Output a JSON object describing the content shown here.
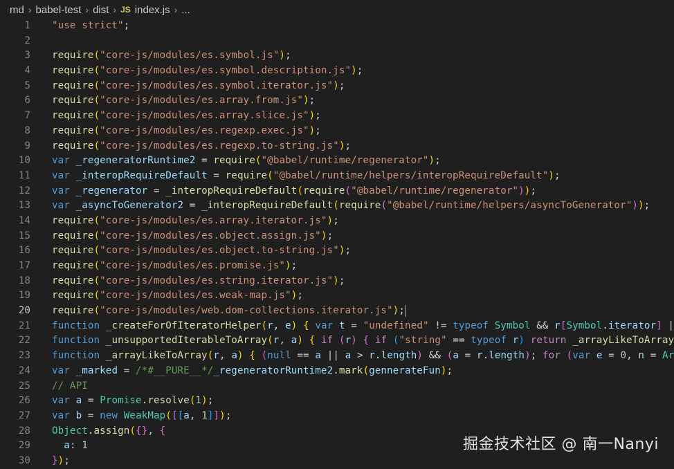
{
  "breadcrumb": {
    "items": [
      "md",
      "babel-test",
      "dist"
    ],
    "file_badge": "JS",
    "file_name": "index.js",
    "more": "..."
  },
  "editor": {
    "active_line": 20,
    "line_numbers": [
      "1",
      "2",
      "3",
      "4",
      "5",
      "6",
      "7",
      "8",
      "9",
      "10",
      "11",
      "12",
      "13",
      "14",
      "15",
      "16",
      "17",
      "18",
      "19",
      "20",
      "21",
      "22",
      "23",
      "24",
      "25",
      "26",
      "27",
      "28",
      "29",
      "30"
    ],
    "lines": [
      [
        [
          "str",
          "\"use strict\""
        ],
        [
          "op",
          ";"
        ]
      ],
      [],
      [
        [
          "fn",
          "require"
        ],
        [
          "pn",
          "("
        ],
        [
          "str",
          "\"core-js/modules/es.symbol.js\""
        ],
        [
          "pn",
          ")"
        ],
        [
          "op",
          ";"
        ]
      ],
      [
        [
          "fn",
          "require"
        ],
        [
          "pn",
          "("
        ],
        [
          "str",
          "\"core-js/modules/es.symbol.description.js\""
        ],
        [
          "pn",
          ")"
        ],
        [
          "op",
          ";"
        ]
      ],
      [
        [
          "fn",
          "require"
        ],
        [
          "pn",
          "("
        ],
        [
          "str",
          "\"core-js/modules/es.symbol.iterator.js\""
        ],
        [
          "pn",
          ")"
        ],
        [
          "op",
          ";"
        ]
      ],
      [
        [
          "fn",
          "require"
        ],
        [
          "pn",
          "("
        ],
        [
          "str",
          "\"core-js/modules/es.array.from.js\""
        ],
        [
          "pn",
          ")"
        ],
        [
          "op",
          ";"
        ]
      ],
      [
        [
          "fn",
          "require"
        ],
        [
          "pn",
          "("
        ],
        [
          "str",
          "\"core-js/modules/es.array.slice.js\""
        ],
        [
          "pn",
          ")"
        ],
        [
          "op",
          ";"
        ]
      ],
      [
        [
          "fn",
          "require"
        ],
        [
          "pn",
          "("
        ],
        [
          "str",
          "\"core-js/modules/es.regexp.exec.js\""
        ],
        [
          "pn",
          ")"
        ],
        [
          "op",
          ";"
        ]
      ],
      [
        [
          "fn",
          "require"
        ],
        [
          "pn",
          "("
        ],
        [
          "str",
          "\"core-js/modules/es.regexp.to-string.js\""
        ],
        [
          "pn",
          ")"
        ],
        [
          "op",
          ";"
        ]
      ],
      [
        [
          "kw",
          "var"
        ],
        [
          "op",
          " "
        ],
        [
          "var",
          "_regeneratorRuntime2"
        ],
        [
          "op",
          " = "
        ],
        [
          "fn",
          "require"
        ],
        [
          "pn",
          "("
        ],
        [
          "str",
          "\"@babel/runtime/regenerator\""
        ],
        [
          "pn",
          ")"
        ],
        [
          "op",
          ";"
        ]
      ],
      [
        [
          "kw",
          "var"
        ],
        [
          "op",
          " "
        ],
        [
          "var",
          "_interopRequireDefault"
        ],
        [
          "op",
          " = "
        ],
        [
          "fn",
          "require"
        ],
        [
          "pn",
          "("
        ],
        [
          "str",
          "\"@babel/runtime/helpers/interopRequireDefault\""
        ],
        [
          "pn",
          ")"
        ],
        [
          "op",
          ";"
        ]
      ],
      [
        [
          "kw",
          "var"
        ],
        [
          "op",
          " "
        ],
        [
          "var",
          "_regenerator"
        ],
        [
          "op",
          " = "
        ],
        [
          "fn",
          "_interopRequireDefault"
        ],
        [
          "pn",
          "("
        ],
        [
          "fn",
          "require"
        ],
        [
          "pn2",
          "("
        ],
        [
          "str",
          "\"@babel/runtime/regenerator\""
        ],
        [
          "pn2",
          ")"
        ],
        [
          "pn",
          ")"
        ],
        [
          "op",
          ";"
        ]
      ],
      [
        [
          "kw",
          "var"
        ],
        [
          "op",
          " "
        ],
        [
          "var",
          "_asyncToGenerator2"
        ],
        [
          "op",
          " = "
        ],
        [
          "fn",
          "_interopRequireDefault"
        ],
        [
          "pn",
          "("
        ],
        [
          "fn",
          "require"
        ],
        [
          "pn2",
          "("
        ],
        [
          "str",
          "\"@babel/runtime/helpers/asyncToGenerator\""
        ],
        [
          "pn2",
          ")"
        ],
        [
          "pn",
          ")"
        ],
        [
          "op",
          ";"
        ]
      ],
      [
        [
          "fn",
          "require"
        ],
        [
          "pn",
          "("
        ],
        [
          "str",
          "\"core-js/modules/es.array.iterator.js\""
        ],
        [
          "pn",
          ")"
        ],
        [
          "op",
          ";"
        ]
      ],
      [
        [
          "fn",
          "require"
        ],
        [
          "pn",
          "("
        ],
        [
          "str",
          "\"core-js/modules/es.object.assign.js\""
        ],
        [
          "pn",
          ")"
        ],
        [
          "op",
          ";"
        ]
      ],
      [
        [
          "fn",
          "require"
        ],
        [
          "pn",
          "("
        ],
        [
          "str",
          "\"core-js/modules/es.object.to-string.js\""
        ],
        [
          "pn",
          ")"
        ],
        [
          "op",
          ";"
        ]
      ],
      [
        [
          "fn",
          "require"
        ],
        [
          "pn",
          "("
        ],
        [
          "str",
          "\"core-js/modules/es.promise.js\""
        ],
        [
          "pn",
          ")"
        ],
        [
          "op",
          ";"
        ]
      ],
      [
        [
          "fn",
          "require"
        ],
        [
          "pn",
          "("
        ],
        [
          "str",
          "\"core-js/modules/es.string.iterator.js\""
        ],
        [
          "pn",
          ")"
        ],
        [
          "op",
          ";"
        ]
      ],
      [
        [
          "fn",
          "require"
        ],
        [
          "pn",
          "("
        ],
        [
          "str",
          "\"core-js/modules/es.weak-map.js\""
        ],
        [
          "pn",
          ")"
        ],
        [
          "op",
          ";"
        ]
      ],
      [
        [
          "fn",
          "require"
        ],
        [
          "pn",
          "("
        ],
        [
          "str",
          "\"core-js/modules/web.dom-collections.iterator.js\""
        ],
        [
          "pn",
          ")"
        ],
        [
          "op",
          ";"
        ],
        [
          "cursor",
          ""
        ]
      ],
      [
        [
          "kw",
          "function"
        ],
        [
          "op",
          " "
        ],
        [
          "fn",
          "_createForOfIteratorHelper"
        ],
        [
          "pn",
          "("
        ],
        [
          "var",
          "r"
        ],
        [
          "op",
          ", "
        ],
        [
          "var",
          "e"
        ],
        [
          "pn",
          ")"
        ],
        [
          "op",
          " "
        ],
        [
          "pn",
          "{"
        ],
        [
          "op",
          " "
        ],
        [
          "kw",
          "var"
        ],
        [
          "op",
          " "
        ],
        [
          "var",
          "t"
        ],
        [
          "op",
          " = "
        ],
        [
          "str",
          "\"undefined\""
        ],
        [
          "op",
          " != "
        ],
        [
          "kw",
          "typeof"
        ],
        [
          "op",
          " "
        ],
        [
          "cls",
          "Symbol"
        ],
        [
          "op",
          " && "
        ],
        [
          "var",
          "r"
        ],
        [
          "pn2",
          "["
        ],
        [
          "cls",
          "Symbol"
        ],
        [
          "op",
          "."
        ],
        [
          "var",
          "iterator"
        ],
        [
          "pn2",
          "]"
        ],
        [
          "op",
          " |"
        ]
      ],
      [
        [
          "kw",
          "function"
        ],
        [
          "op",
          " "
        ],
        [
          "fn",
          "_unsupportedIterableToArray"
        ],
        [
          "pn",
          "("
        ],
        [
          "var",
          "r"
        ],
        [
          "op",
          ", "
        ],
        [
          "var",
          "a"
        ],
        [
          "pn",
          ")"
        ],
        [
          "op",
          " "
        ],
        [
          "pn",
          "{"
        ],
        [
          "op",
          " "
        ],
        [
          "kw2",
          "if"
        ],
        [
          "op",
          " "
        ],
        [
          "pn2",
          "("
        ],
        [
          "var",
          "r"
        ],
        [
          "pn2",
          ")"
        ],
        [
          "op",
          " "
        ],
        [
          "pn2",
          "{"
        ],
        [
          "op",
          " "
        ],
        [
          "kw2",
          "if"
        ],
        [
          "op",
          " "
        ],
        [
          "pn3",
          "("
        ],
        [
          "str",
          "\"string\""
        ],
        [
          "op",
          " == "
        ],
        [
          "kw",
          "typeof"
        ],
        [
          "op",
          " "
        ],
        [
          "var",
          "r"
        ],
        [
          "pn3",
          ")"
        ],
        [
          "op",
          " "
        ],
        [
          "kw2",
          "return"
        ],
        [
          "op",
          " "
        ],
        [
          "fn",
          "_arrayLikeToArray"
        ]
      ],
      [
        [
          "kw",
          "function"
        ],
        [
          "op",
          " "
        ],
        [
          "fn",
          "_arrayLikeToArray"
        ],
        [
          "pn",
          "("
        ],
        [
          "var",
          "r"
        ],
        [
          "op",
          ", "
        ],
        [
          "var",
          "a"
        ],
        [
          "pn",
          ")"
        ],
        [
          "op",
          " "
        ],
        [
          "pn",
          "{"
        ],
        [
          "op",
          " "
        ],
        [
          "pn2",
          "("
        ],
        [
          "kw",
          "null"
        ],
        [
          "op",
          " == "
        ],
        [
          "var",
          "a"
        ],
        [
          "op",
          " || "
        ],
        [
          "var",
          "a"
        ],
        [
          "op",
          " > "
        ],
        [
          "var",
          "r"
        ],
        [
          "op",
          "."
        ],
        [
          "var",
          "length"
        ],
        [
          "pn2",
          ")"
        ],
        [
          "op",
          " && "
        ],
        [
          "pn2",
          "("
        ],
        [
          "var",
          "a"
        ],
        [
          "op",
          " = "
        ],
        [
          "var",
          "r"
        ],
        [
          "op",
          "."
        ],
        [
          "var",
          "length"
        ],
        [
          "pn2",
          ")"
        ],
        [
          "op",
          "; "
        ],
        [
          "kw2",
          "for"
        ],
        [
          "op",
          " "
        ],
        [
          "pn2",
          "("
        ],
        [
          "kw",
          "var"
        ],
        [
          "op",
          " "
        ],
        [
          "var",
          "e"
        ],
        [
          "op",
          " = "
        ],
        [
          "num",
          "0"
        ],
        [
          "op",
          ", "
        ],
        [
          "var",
          "n"
        ],
        [
          "op",
          " = "
        ],
        [
          "cls",
          "Ar"
        ]
      ],
      [
        [
          "kw",
          "var"
        ],
        [
          "op",
          " "
        ],
        [
          "var",
          "_marked"
        ],
        [
          "op",
          " = "
        ],
        [
          "cmt",
          "/*#__PURE__*/"
        ],
        [
          "var",
          "_regeneratorRuntime2"
        ],
        [
          "op",
          "."
        ],
        [
          "fn",
          "mark"
        ],
        [
          "pn",
          "("
        ],
        [
          "var",
          "gennerateFun"
        ],
        [
          "pn",
          ")"
        ],
        [
          "op",
          ";"
        ]
      ],
      [
        [
          "cmt",
          "// API"
        ]
      ],
      [
        [
          "kw",
          "var"
        ],
        [
          "op",
          " "
        ],
        [
          "var",
          "a"
        ],
        [
          "op",
          " = "
        ],
        [
          "cls",
          "Promise"
        ],
        [
          "op",
          "."
        ],
        [
          "fn",
          "resolve"
        ],
        [
          "pn",
          "("
        ],
        [
          "num",
          "1"
        ],
        [
          "pn",
          ")"
        ],
        [
          "op",
          ";"
        ]
      ],
      [
        [
          "kw",
          "var"
        ],
        [
          "op",
          " "
        ],
        [
          "var",
          "b"
        ],
        [
          "op",
          " = "
        ],
        [
          "kw",
          "new"
        ],
        [
          "op",
          " "
        ],
        [
          "cls",
          "WeakMap"
        ],
        [
          "pn",
          "("
        ],
        [
          "pn2",
          "["
        ],
        [
          "pn3",
          "["
        ],
        [
          "var",
          "a"
        ],
        [
          "op",
          ", "
        ],
        [
          "num",
          "1"
        ],
        [
          "pn3",
          "]"
        ],
        [
          "pn2",
          "]"
        ],
        [
          "pn",
          ")"
        ],
        [
          "op",
          ";"
        ]
      ],
      [
        [
          "cls",
          "Object"
        ],
        [
          "op",
          "."
        ],
        [
          "fn",
          "assign"
        ],
        [
          "pn",
          "("
        ],
        [
          "pn2",
          "{}"
        ],
        [
          "op",
          ", "
        ],
        [
          "pn2",
          "{"
        ]
      ],
      [
        [
          "op",
          "  "
        ],
        [
          "var",
          "a"
        ],
        [
          "op",
          ": "
        ],
        [
          "num",
          "1"
        ]
      ],
      [
        [
          "pn2",
          "}"
        ],
        [
          "pn",
          ")"
        ],
        [
          "op",
          ";"
        ]
      ]
    ]
  },
  "watermark": "掘金技术社区 @ 南一Nanyi"
}
